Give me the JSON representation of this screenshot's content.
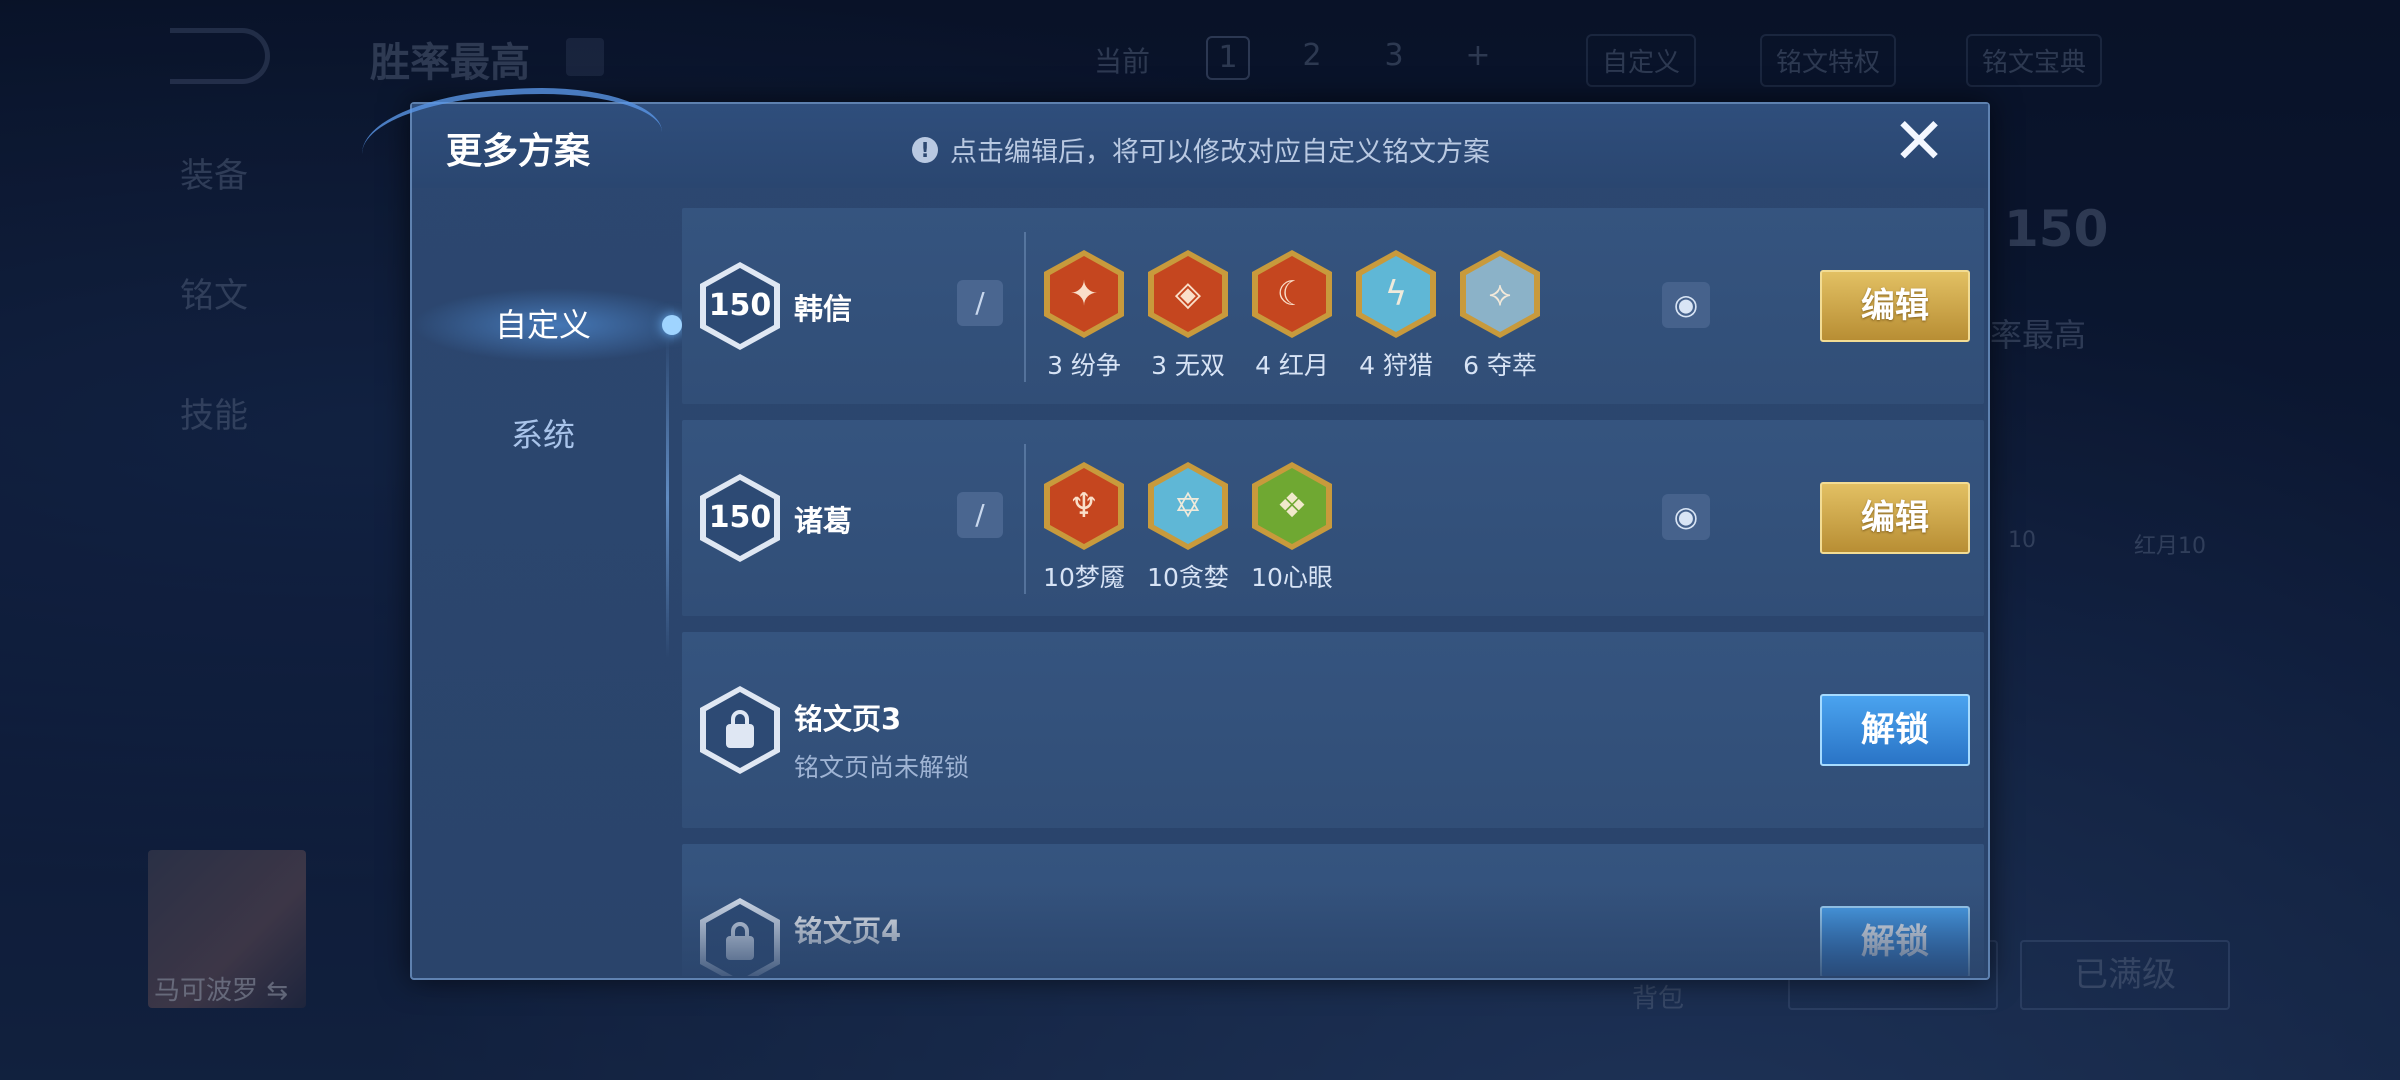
{
  "background": {
    "title": "胜率最高",
    "side_tabs": [
      "装备",
      "铭文",
      "技能"
    ],
    "current_label": "当前",
    "pages": [
      "1",
      "2",
      "3",
      "+"
    ],
    "custom_label": "自定义",
    "rune_privilege": "铭文特权",
    "rune_guide": "铭文宝典",
    "hero_name": "马可波罗",
    "swap_icon": "⇆",
    "bag_label": "背包",
    "upgrade_label": "已满级",
    "level_value": "150",
    "right_best": "率最高",
    "right_rune_labels": [
      "10",
      "红月10"
    ]
  },
  "modal": {
    "title": "更多方案",
    "notice": "点击编辑后，将可以修改对应自定义铭文方案",
    "close_icon": "✕",
    "nav": {
      "custom": "自定义",
      "system": "系统"
    },
    "rows": [
      {
        "level": "150",
        "name": "韩信",
        "runes": [
          {
            "label": "3 纷争",
            "color": "#c5461f"
          },
          {
            "label": "3 无双",
            "color": "#c5461f"
          },
          {
            "label": "4 红月",
            "color": "#c5461f"
          },
          {
            "label": "4 狩猎",
            "color": "#5fb7d6"
          },
          {
            "label": "6 夺萃",
            "color": "#8bb2c8"
          }
        ],
        "edit_label": "编辑"
      },
      {
        "level": "150",
        "name": "诸葛",
        "runes": [
          {
            "label": "10梦魇",
            "color": "#c5461f"
          },
          {
            "label": "10贪婪",
            "color": "#5fb7d6"
          },
          {
            "label": "10心眼",
            "color": "#6fa832"
          }
        ],
        "edit_label": "编辑"
      },
      {
        "name": "铭文页3",
        "subtitle": "铭文页尚未解锁",
        "unlock_label": "解锁"
      },
      {
        "name": "铭文页4",
        "unlock_label": "解锁"
      }
    ],
    "pen_icon": "/",
    "eye_icon": "◉"
  }
}
